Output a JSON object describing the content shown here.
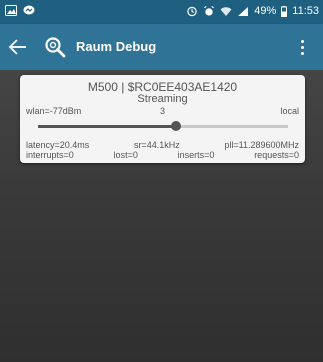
{
  "status_bar": {
    "left_icons": [
      "image-icon",
      "messenger-icon"
    ],
    "right_icons": [
      "sync-icon",
      "alarm-icon",
      "wifi-icon",
      "signal-icon"
    ],
    "battery": "49%",
    "battery_icon": "battery-icon",
    "time": "11:53"
  },
  "app_bar": {
    "back_icon": "back-arrow-icon",
    "app_icon": "magnifier-icon",
    "title": "Raum Debug",
    "menu_icon": "more-vert-icon"
  },
  "device": {
    "title": "M500 | $RC0EE403AE1420",
    "state": "Streaming",
    "wlan": "wlan=-77dBm",
    "volume": "3",
    "volume_fraction": 0.55,
    "source": "local",
    "latency": "latency=20.4ms",
    "sample_rate": "sr=44.1kHz",
    "pll": "pll=11.289600MHz",
    "interrupts": "interrupts=0",
    "lost": "lost=0",
    "inserts": "inserts=0",
    "requests": "requests=0"
  },
  "colors": {
    "status_bar": "#1f5f80",
    "app_bar": "#2f7396",
    "card": "#f4f4f4",
    "background": "#3a3a3a"
  }
}
